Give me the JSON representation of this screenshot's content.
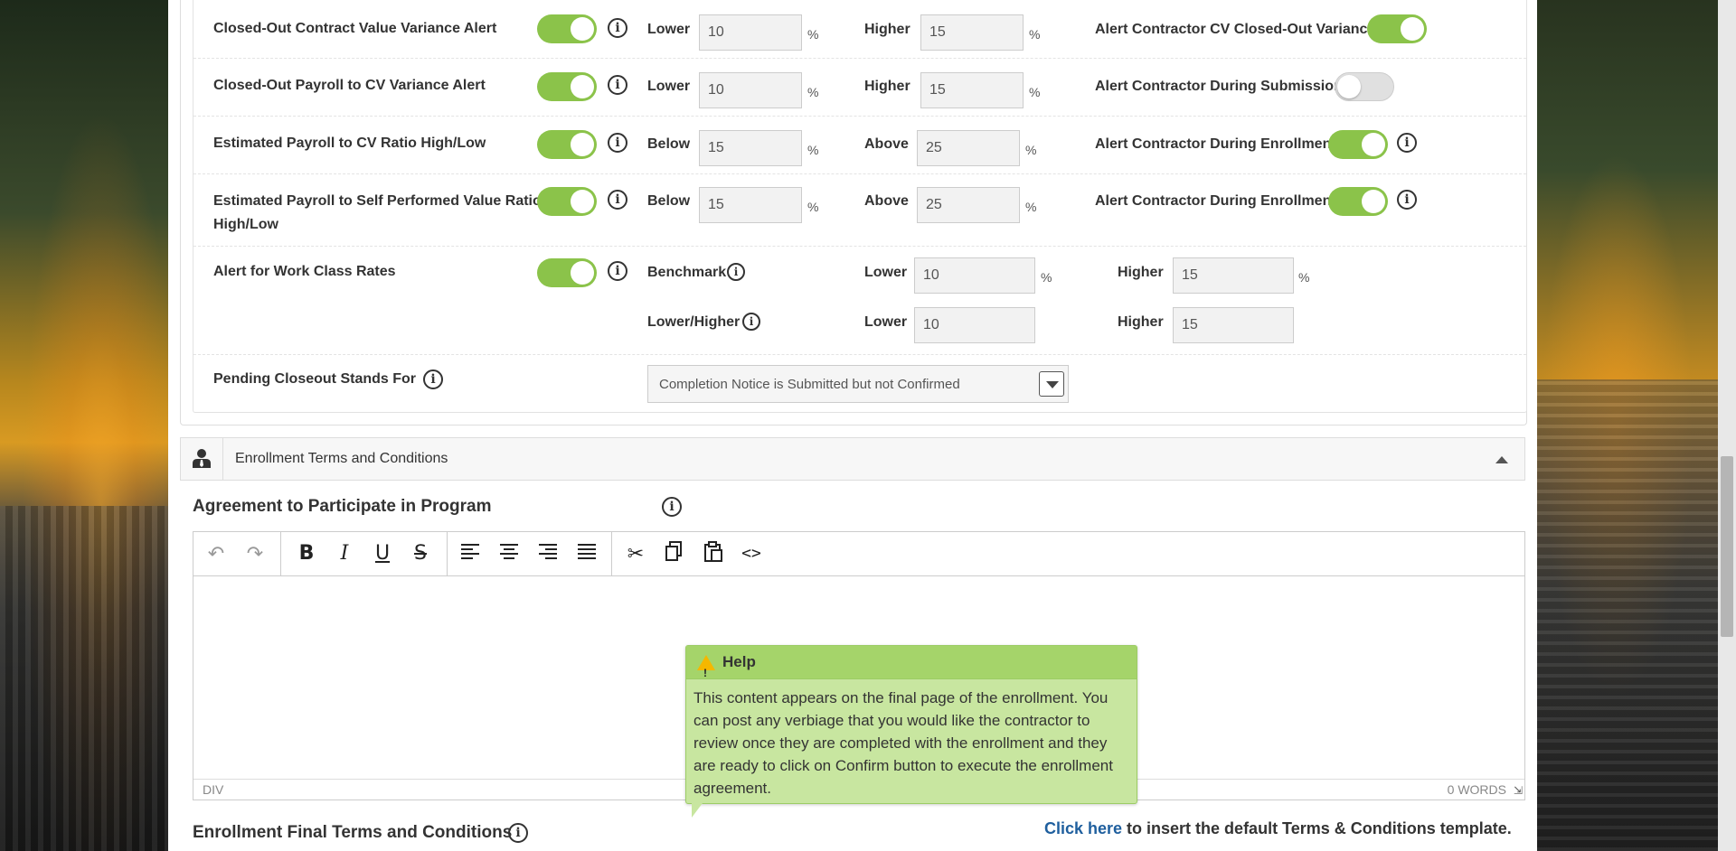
{
  "settings_rows": [
    {
      "label": "Closed-Out Contract Value Variance Alert",
      "toggle_on": true,
      "low_label": "Lower",
      "low_value": "10",
      "low_unit": "%",
      "high_label": "Higher",
      "high_value": "15",
      "high_unit": "%",
      "alert_label": "Alert Contractor CV Closed-Out Variance",
      "alert_on": true
    },
    {
      "label": "Closed-Out Payroll to CV Variance Alert",
      "toggle_on": true,
      "low_label": "Lower",
      "low_value": "10",
      "low_unit": "%",
      "high_label": "Higher",
      "high_value": "15",
      "high_unit": "%",
      "alert_label": "Alert Contractor During Submission",
      "alert_on": false
    },
    {
      "label": "Estimated Payroll to CV Ratio High/Low",
      "toggle_on": true,
      "low_label": "Below",
      "low_value": "15",
      "low_unit": "%",
      "high_label": "Above",
      "high_value": "25",
      "high_unit": "%",
      "alert_label": "Alert Contractor During Enrollment",
      "alert_on": true
    },
    {
      "label_line1": "Estimated Payroll to Self Performed Value Ratio",
      "label_line2": "High/Low",
      "toggle_on": true,
      "low_label": "Below",
      "low_value": "15",
      "low_unit": "%",
      "high_label": "Above",
      "high_value": "25",
      "high_unit": "%",
      "alert_label": "Alert Contractor During Enrollment",
      "alert_on": true
    }
  ],
  "work_class": {
    "label": "Alert for Work Class Rates",
    "toggle_on": true,
    "benchmark_label": "Benchmark",
    "lowhigh_label": "Lower/Higher",
    "benchmark_lower_label": "Lower",
    "benchmark_lower": "10",
    "benchmark_lower_unit": "%",
    "benchmark_higher_label": "Higher",
    "benchmark_higher": "15",
    "benchmark_higher_unit": "%",
    "lh_lower_label": "Lower",
    "lh_lower": "10",
    "lh_higher_label": "Higher",
    "lh_higher": "15"
  },
  "pending_closeout": {
    "label": "Pending Closeout Stands For",
    "selected": "Completion Notice is Submitted but not Confirmed"
  },
  "section": {
    "title": "Enrollment Terms and Conditions"
  },
  "agreement": {
    "title": "Agreement to Participate in Program"
  },
  "editor": {
    "status_left": "DIV",
    "status_right": "0 WORDS"
  },
  "tooltip": {
    "title": "Help",
    "body": "This content appears on the final page of the enrollment. You can post any verbiage that you would like the contractor to review once they are completed with the enrollment and they are ready to click on Confirm button to execute the enrollment agreement."
  },
  "final_terms": {
    "title": "Enrollment Final Terms and Conditions",
    "link_text": "Click here",
    "link_suffix": " to insert the default Terms & Conditions template."
  },
  "colors": {
    "toggle_on": "#8bc34a",
    "tooltip_bg": "#c8e6a0",
    "link": "#1f5f9e"
  }
}
